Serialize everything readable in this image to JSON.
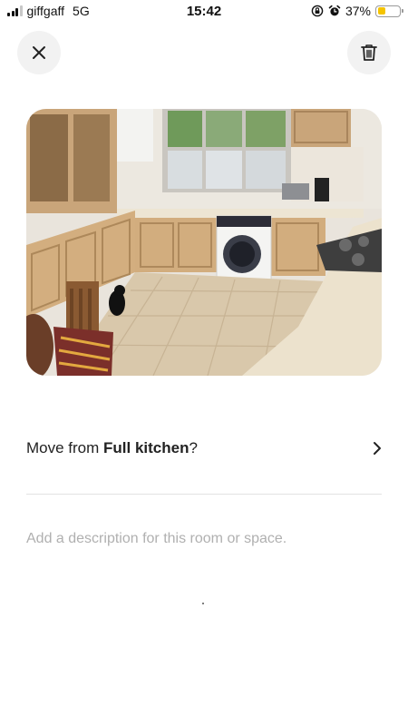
{
  "status_bar": {
    "carrier": "giffgaff",
    "network": "5G",
    "time": "15:42",
    "battery": "37%",
    "battery_level": 0.37,
    "icons": [
      "signal-icon",
      "orientation-lock-icon",
      "alarm-icon",
      "battery-icon"
    ]
  },
  "toolbar": {
    "close_icon": "close-icon",
    "delete_icon": "trash-icon"
  },
  "photo": {
    "subject": "kitchen-photo"
  },
  "move_row": {
    "prefix": "Move from ",
    "room": "Full kitchen",
    "suffix": "?",
    "icon": "chevron-right-icon"
  },
  "description": {
    "value": "",
    "placeholder": "Add a description for this room or space."
  },
  "colors": {
    "battery_fill": "#f5c400",
    "button_bg": "#f2f2f2",
    "placeholder": "#b0b0b0",
    "divider": "#e2e2e2"
  }
}
